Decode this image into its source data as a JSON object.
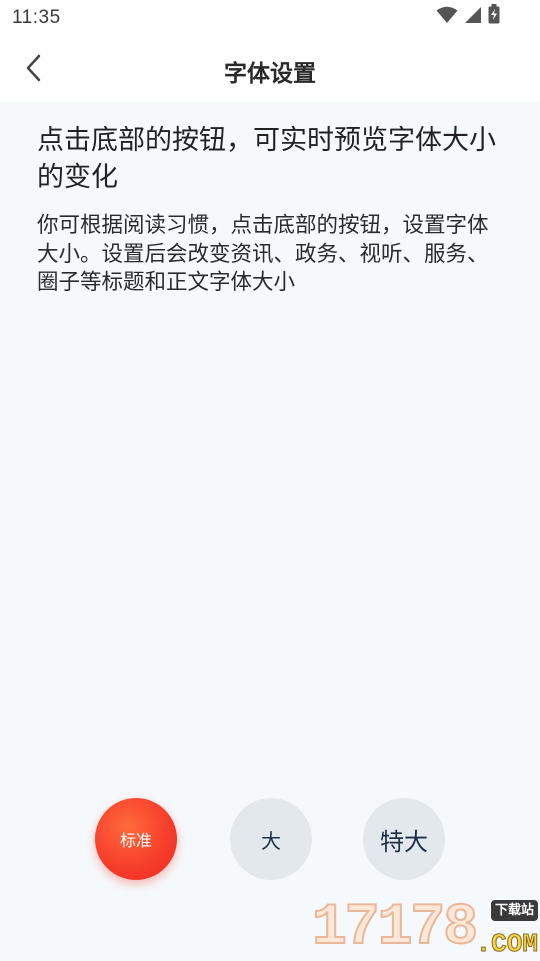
{
  "status_bar": {
    "time": "11:35",
    "icons": [
      "wifi-icon",
      "cellular-signal-icon",
      "battery-charging-icon"
    ]
  },
  "nav": {
    "back_icon": "chevron-left-icon",
    "title": "字体设置"
  },
  "preview": {
    "title": "点击底部的按钮，可实时预览字体大小的变化",
    "body": "你可根据阅读习惯，点击底部的按钮，设置字体大小。设置后会改变资讯、政务、视听、服务、圈子等标题和正文字体大小"
  },
  "font_options": {
    "selected": "标准",
    "options": [
      {
        "label": "标准"
      },
      {
        "label": "大"
      },
      {
        "label": "特大"
      }
    ]
  },
  "colors": {
    "accent": "#f63b2a",
    "background": "#f6f9fc",
    "option_inactive": "#e3e8ec"
  },
  "watermark": {
    "digits": "17178",
    "tag": "下载站",
    "suffix": ".COM"
  }
}
